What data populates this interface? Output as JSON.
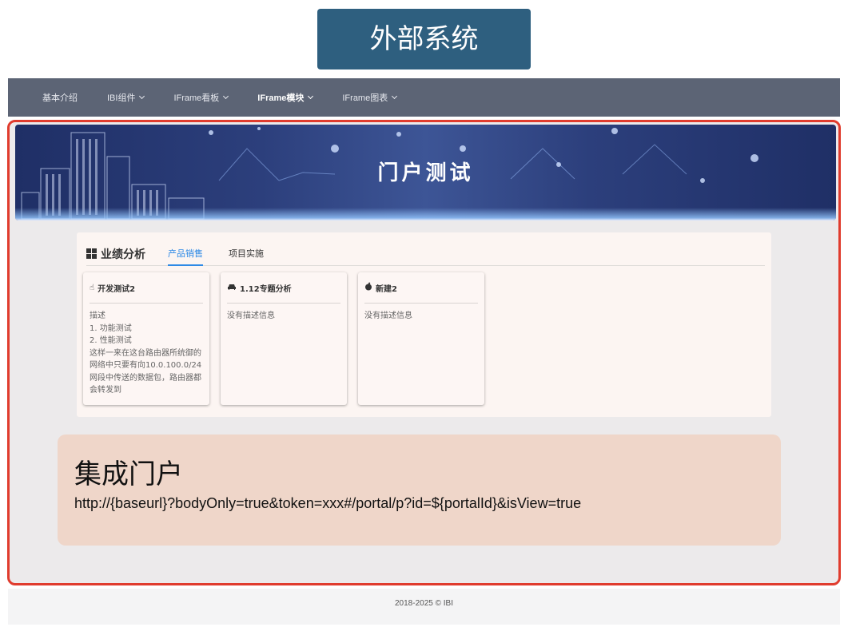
{
  "external_title": "外部系统",
  "nav": {
    "items": [
      {
        "label": "基本介绍",
        "dropdown": false,
        "active": false
      },
      {
        "label": "IBI组件",
        "dropdown": true,
        "active": false
      },
      {
        "label": "IFrame看板",
        "dropdown": true,
        "active": false
      },
      {
        "label": "IFrame模块",
        "dropdown": true,
        "active": true
      },
      {
        "label": "IFrame图表",
        "dropdown": true,
        "active": false
      }
    ]
  },
  "banner": {
    "title": "门户测试"
  },
  "panel": {
    "heading": "业绩分析",
    "tabs": [
      {
        "label": "产品销售",
        "active": true
      },
      {
        "label": "项目实施",
        "active": false
      }
    ],
    "cards": [
      {
        "icon": "hand-icon",
        "title": "开发测试2",
        "body": "描述\n1. 功能测试\n2. 性能测试\n这样一来在这台路由器所统御的网络中只要有向10.0.100.0/24网段中传送的数据包，路由器都会转发到"
      },
      {
        "icon": "car-icon",
        "title": "1.12专题分析",
        "body": "没有描述信息"
      },
      {
        "icon": "apple-icon",
        "title": "新建2",
        "body": "没有描述信息"
      }
    ]
  },
  "integration": {
    "title": "集成门户",
    "url": "http://{baseurl}?bodyOnly=true&token=xxx#/portal/p?id=${portalId}&isView=true"
  },
  "footer": {
    "text": "2018-2025 © IBI"
  },
  "colors": {
    "header_badge": "#2e5f7f",
    "nav_bar": "#5c6475",
    "frame_border": "#e03c2e",
    "tab_active": "#2e8ae6",
    "integration_bg": "#efd6c9"
  }
}
